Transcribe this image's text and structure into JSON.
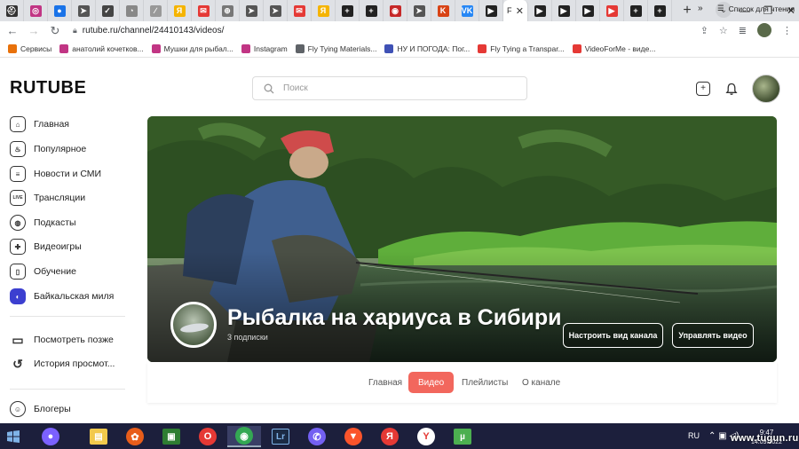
{
  "browser": {
    "tabs": [
      {
        "color": "#333333",
        "glyph": "⛑"
      },
      {
        "color": "#c13584",
        "glyph": "◎"
      },
      {
        "color": "#1a73e8",
        "glyph": "●"
      },
      {
        "color": "#555555",
        "glyph": "➤"
      },
      {
        "color": "#444444",
        "glyph": "✓"
      },
      {
        "color": "#888888",
        "glyph": "◔"
      },
      {
        "color": "#999999",
        "glyph": "∕"
      },
      {
        "color": "#f5b400",
        "glyph": "Я"
      },
      {
        "color": "#e53935",
        "glyph": "✉"
      },
      {
        "color": "#777777",
        "glyph": "⊕"
      },
      {
        "color": "#555555",
        "glyph": "➤"
      },
      {
        "color": "#555555",
        "glyph": "➤"
      },
      {
        "color": "#e53935",
        "glyph": "✉"
      },
      {
        "color": "#f5b400",
        "glyph": "Я"
      },
      {
        "color": "#222222",
        "glyph": "+"
      },
      {
        "color": "#222222",
        "glyph": "+"
      },
      {
        "color": "#c62828",
        "glyph": "◉"
      },
      {
        "color": "#555555",
        "glyph": "➤"
      },
      {
        "color": "#d84315",
        "glyph": "K"
      },
      {
        "color": "#2787f5",
        "glyph": "VK"
      },
      {
        "color": "#222222",
        "glyph": "▶"
      }
    ],
    "active_tab_letter": "F",
    "tabs_after": [
      {
        "color": "#222222",
        "glyph": "▶"
      },
      {
        "color": "#222222",
        "glyph": "▶"
      },
      {
        "color": "#222222",
        "glyph": "▶"
      },
      {
        "color": "#e53935",
        "glyph": "▶"
      },
      {
        "color": "#222222",
        "glyph": "+"
      },
      {
        "color": "#222222",
        "glyph": "+"
      }
    ],
    "url": "rutube.ru/channel/24410143/videos/",
    "bookmarks": [
      {
        "label": "Сервисы",
        "color": "#e8710a"
      },
      {
        "label": "анатолий кочетков...",
        "color": "#c13584"
      },
      {
        "label": "Мушки для рыбал...",
        "color": "#c13584"
      },
      {
        "label": "Instagram",
        "color": "#c13584"
      },
      {
        "label": "Fly Tying Materials...",
        "color": "#5f6368"
      },
      {
        "label": "НУ И ПОГОДА: Пог...",
        "color": "#3f51b5"
      },
      {
        "label": "Fly Tying a Transpar...",
        "color": "#e53935"
      },
      {
        "label": "VideoForMe - виде...",
        "color": "#e53935"
      }
    ],
    "bookmarks_more": "»",
    "reading_list": "Список для чтения"
  },
  "header": {
    "logo": "RUTUBE",
    "search_placeholder": "Поиск"
  },
  "sidebar": {
    "items": [
      {
        "label": "Главная",
        "icon": "home-icon",
        "glyph": "⌂"
      },
      {
        "label": "Популярное",
        "icon": "fire-icon",
        "glyph": "♨"
      },
      {
        "label": "Новости и СМИ",
        "icon": "news-icon",
        "glyph": "≡"
      },
      {
        "label": "Трансляции",
        "icon": "live-icon",
        "glyph": "LIVE"
      },
      {
        "label": "Подкасты",
        "icon": "podcast-icon",
        "glyph": "◍"
      },
      {
        "label": "Видеоигры",
        "icon": "gamepad-icon",
        "glyph": "✚"
      },
      {
        "label": "Обучение",
        "icon": "book-icon",
        "glyph": "▯"
      },
      {
        "label": "Байкальская миля",
        "icon": "baikal-mile-icon",
        "glyph": "◐"
      },
      {
        "label": "Посмотреть позже",
        "icon": "bookmark-icon",
        "glyph": "▭"
      },
      {
        "label": "История просмот...",
        "icon": "history-icon",
        "glyph": "↺"
      },
      {
        "label": "Блогеры",
        "icon": "bloggers-icon",
        "glyph": "☺"
      }
    ]
  },
  "channel": {
    "title": "Рыбалка на хариуса в Сибири",
    "subscribers": "3 подписки",
    "customize_label": "Настроить вид канала",
    "manage_label": "Управлять видео",
    "tabs": [
      {
        "label": "Главная",
        "active": false
      },
      {
        "label": "Видео",
        "active": true
      },
      {
        "label": "Плейлисты",
        "active": false
      },
      {
        "label": "О канале",
        "active": false
      }
    ],
    "accent": "#f2675d"
  },
  "taskbar": {
    "language": "RU",
    "time": "9:47",
    "date": "14.09.2022",
    "watermark": "www.tugun.ru",
    "apps": [
      {
        "name": "alice-icon",
        "color": "#7b61ff",
        "glyph": "●"
      },
      {
        "name": "file-explorer-icon",
        "color": "#f2c94c",
        "glyph": "▤"
      },
      {
        "name": "media-player-icon",
        "color": "#e85d1a",
        "glyph": "✿"
      },
      {
        "name": "terminal-icon",
        "color": "#2e7d32",
        "glyph": "▣"
      },
      {
        "name": "opera-icon",
        "color": "#e53935",
        "glyph": "O"
      },
      {
        "name": "chrome-icon",
        "color": "#34a853",
        "glyph": "◉"
      },
      {
        "name": "lightroom-icon",
        "color": "#1b2a44",
        "glyph": "Lr"
      },
      {
        "name": "viber-icon",
        "color": "#7360f2",
        "glyph": "✆"
      },
      {
        "name": "brave-icon",
        "color": "#fb542b",
        "glyph": "▼"
      },
      {
        "name": "yandex-icon",
        "color": "#e53935",
        "glyph": "Я"
      },
      {
        "name": "yandex-browser-icon",
        "color": "#ffffff",
        "glyph": "Y"
      },
      {
        "name": "utorrent-icon",
        "color": "#4caf50",
        "glyph": "µ"
      }
    ]
  }
}
